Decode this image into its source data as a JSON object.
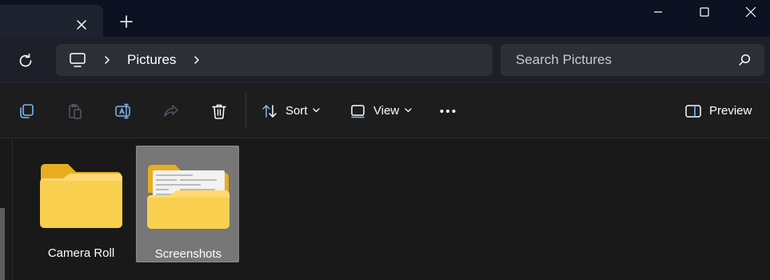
{
  "window": {
    "tab_close_icon": "close-icon",
    "new_tab_icon": "plus-icon",
    "controls": [
      "minimize-icon",
      "maximize-icon",
      "close-icon"
    ]
  },
  "address_bar": {
    "refresh_icon": "refresh-icon",
    "root_icon": "this-pc-icon",
    "breadcrumb": [
      "Pictures"
    ],
    "search_placeholder": "Search Pictures"
  },
  "toolbar": {
    "icons": [
      "copy-icon",
      "paste-icon",
      "rename-icon",
      "share-icon",
      "delete-icon"
    ],
    "sort_label": "Sort",
    "view_label": "View",
    "more_icon": "ellipsis-icon",
    "preview_label": "Preview"
  },
  "items": [
    {
      "label": "Camera Roll",
      "type": "folder",
      "selected": false
    },
    {
      "label": "Screenshots",
      "type": "folder-with-preview",
      "selected": true
    }
  ],
  "colors": {
    "accent_folder": "#f5c636",
    "accent_blue": "#7fb8f0",
    "background": "#191919",
    "selection": "#777777"
  }
}
